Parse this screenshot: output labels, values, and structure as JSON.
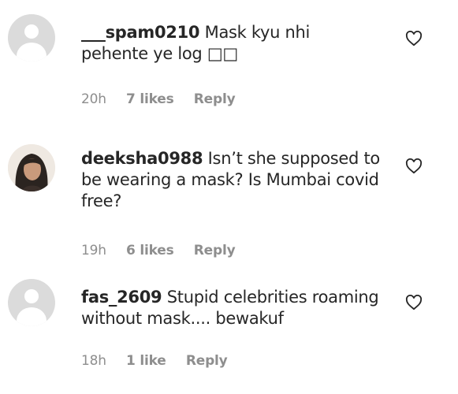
{
  "comments": [
    {
      "username": "___spam0210",
      "text": "Mask kyu nhi pehente ye log □□",
      "time": "20h",
      "likes": "7 likes",
      "reply": "Reply"
    },
    {
      "username": "deeksha0988",
      "text": "Isn’t she supposed to be wearing a mask? Is Mumbai covid free?",
      "time": "19h",
      "likes": "6 likes",
      "reply": "Reply"
    },
    {
      "username": "fas_2609",
      "text": "Stupid celebrities roaming without mask.... bewakuf",
      "time": "18h",
      "likes": "1 like",
      "reply": "Reply"
    }
  ],
  "icons": {
    "like": "heart-outline-icon",
    "avatar_default": "default-avatar-icon"
  },
  "colors": {
    "text": "#262626",
    "secondary": "#8e8e8e",
    "avatar_placeholder": "#dbdbdb"
  }
}
